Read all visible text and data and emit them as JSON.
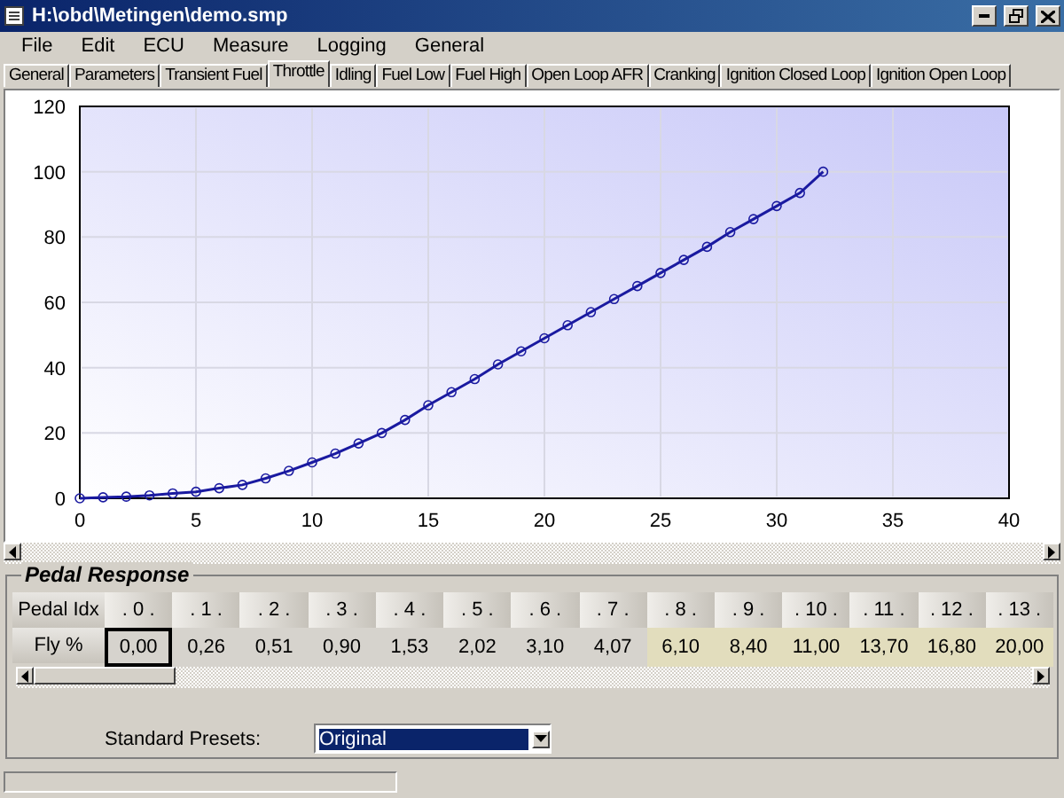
{
  "window": {
    "title": "H:\\obd\\Metingen\\demo.smp"
  },
  "menu": [
    "File",
    "Edit",
    "ECU",
    "Measure",
    "Logging",
    "General"
  ],
  "tabs": [
    {
      "label": "General",
      "selected": false
    },
    {
      "label": "Parameters",
      "selected": false
    },
    {
      "label": "Transient Fuel",
      "selected": false
    },
    {
      "label": "Throttle",
      "selected": true
    },
    {
      "label": "Idling",
      "selected": false
    },
    {
      "label": "Fuel Low",
      "selected": false
    },
    {
      "label": "Fuel High",
      "selected": false
    },
    {
      "label": "Open Loop AFR",
      "selected": false
    },
    {
      "label": "Cranking",
      "selected": false
    },
    {
      "label": "Ignition Closed Loop",
      "selected": false
    },
    {
      "label": "Ignition Open Loop",
      "selected": false
    }
  ],
  "chart": {
    "chart_data": {
      "type": "line",
      "grid": true,
      "xlim": [
        0,
        40
      ],
      "ylim": [
        0,
        120
      ],
      "xticks": [
        0,
        5,
        10,
        15,
        20,
        25,
        30,
        35,
        40
      ],
      "yticks": [
        0,
        20,
        40,
        60,
        80,
        100,
        120
      ],
      "x": [
        0,
        1,
        2,
        3,
        4,
        5,
        6,
        7,
        8,
        9,
        10,
        11,
        12,
        13,
        14,
        15,
        16,
        17,
        18,
        19,
        20,
        21,
        22,
        23,
        24,
        25,
        26,
        27,
        28,
        29,
        30,
        31,
        32
      ],
      "series": [
        {
          "color": "#1a1aa0",
          "marker": "circle",
          "values": [
            0,
            0.3,
            0.5,
            0.9,
            1.5,
            2,
            3.1,
            4.1,
            6.1,
            8.4,
            11,
            13.7,
            16.8,
            20,
            24,
            28.5,
            32.5,
            36.5,
            41,
            45,
            49,
            53,
            57,
            61,
            65,
            69,
            73,
            77,
            81.5,
            85.5,
            89.5,
            93.5,
            100
          ]
        }
      ]
    }
  },
  "pedal_response": {
    "title": "Pedal Response",
    "row_headers": [
      "Pedal Idx",
      "Fly %"
    ],
    "columns": [
      {
        "header": ". 0 .",
        "value": "0,00",
        "selected": true,
        "color": "#d6d3cd"
      },
      {
        "header": ". 1 .",
        "value": "0,26",
        "selected": false,
        "color": "#d6d3cd"
      },
      {
        "header": ". 2 .",
        "value": "0,51",
        "selected": false,
        "color": "#d6d3cd"
      },
      {
        "header": ". 3 .",
        "value": "0,90",
        "selected": false,
        "color": "#d6d3cd"
      },
      {
        "header": ". 4 .",
        "value": "1,53",
        "selected": false,
        "color": "#d6d3cd"
      },
      {
        "header": ". 5 .",
        "value": "2,02",
        "selected": false,
        "color": "#d6d3cd"
      },
      {
        "header": ". 6 .",
        "value": "3,10",
        "selected": false,
        "color": "#d6d3cd"
      },
      {
        "header": ". 7 .",
        "value": "4,07",
        "selected": false,
        "color": "#d6d3cd"
      },
      {
        "header": ". 8 .",
        "value": "6,10",
        "selected": false,
        "color": "#e2ddbd"
      },
      {
        "header": ". 9 .",
        "value": "8,40",
        "selected": false,
        "color": "#e2ddbd"
      },
      {
        "header": ". 10 .",
        "value": "11,00",
        "selected": false,
        "color": "#e2ddbd"
      },
      {
        "header": ". 11 .",
        "value": "13,70",
        "selected": false,
        "color": "#e2ddbd"
      },
      {
        "header": ". 12 .",
        "value": "16,80",
        "selected": false,
        "color": "#e2ddbd"
      },
      {
        "header": ". 13 .",
        "value": "20,00",
        "selected": false,
        "color": "#e2ddbd"
      }
    ],
    "presets": {
      "label": "Standard Presets:",
      "value": "Original"
    }
  }
}
